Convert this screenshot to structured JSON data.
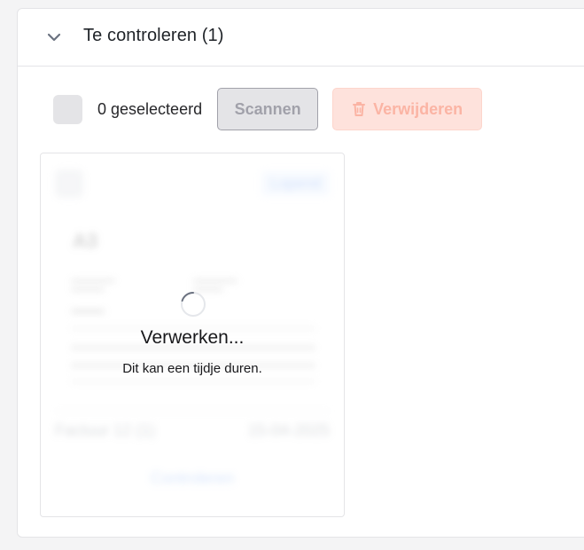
{
  "section": {
    "title": "Te controleren (1)",
    "collapse_icon": "chevron-down-icon"
  },
  "toolbar": {
    "selected_label": "0 geselecteerd",
    "scan_label": "Scannen",
    "delete_label": "Verwijderen",
    "delete_icon": "trash-icon"
  },
  "card": {
    "status": "Lopend",
    "document_name": "Factuur 12 (1)",
    "date": "15-04-2025",
    "review_label": "Controleren",
    "processing_title": "Verwerken...",
    "processing_subtitle": "Dit kan een tijdje duren."
  },
  "colors": {
    "accent_blue": "#3b82f6",
    "danger_light": "#fee2dc",
    "danger_text": "#fbb4a4",
    "neutral_bg": "#e4e4e7"
  }
}
